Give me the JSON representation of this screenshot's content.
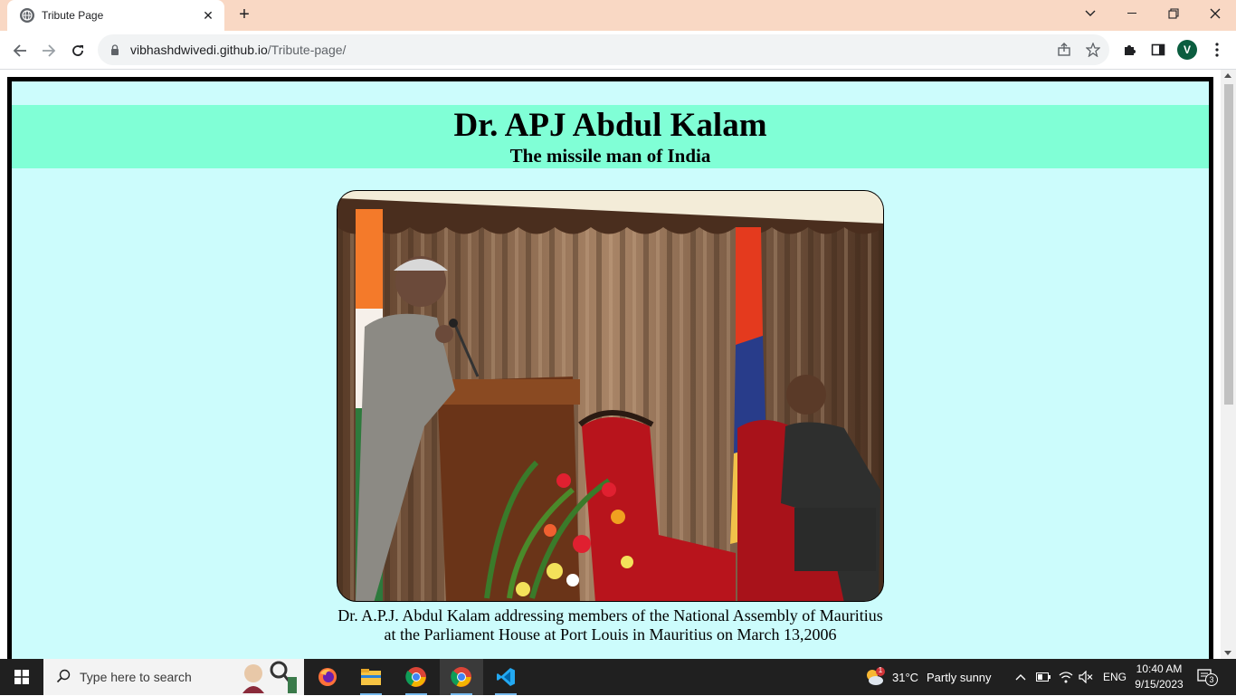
{
  "browser": {
    "tab_title": "Tribute Page",
    "tab_close": "✕",
    "new_tab": "+",
    "url_host": "vibhashdwivedi.github.io",
    "url_path": "/Tribute-page/",
    "profile_initial": "V"
  },
  "page": {
    "title": "Dr. APJ Abdul Kalam",
    "subtitle": "The missile man of India",
    "caption_line1": "Dr. A.P.J. Abdul Kalam addressing members of the National Assembly of Mauritius",
    "caption_line2": "at the Parliament House at Port Louis in Mauritius on March 13,2006",
    "colors": {
      "frame_bg": "#ccfcfc",
      "header_bg": "#80ffd6",
      "border": "#000000"
    }
  },
  "taskbar": {
    "search_placeholder": "Type here to search",
    "weather_temp": "31°C",
    "weather_desc": "Partly sunny",
    "language": "ENG",
    "time": "10:40 AM",
    "date": "9/15/2023",
    "notification_count": "3",
    "weather_badge": "1",
    "apps": [
      "firefox-icon",
      "file-explorer-icon",
      "chrome-icon",
      "chrome-icon",
      "vscode-icon"
    ]
  }
}
